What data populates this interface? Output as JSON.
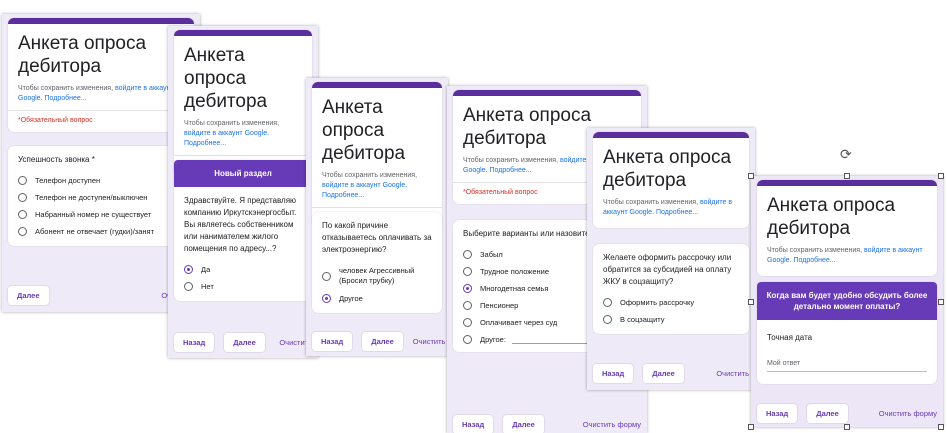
{
  "title": "Анкета опроса дебитора",
  "signin_text": "Чтобы сохранить изменения,",
  "signin_link": "войдите в аккаунт Google.",
  "signin_more": "Подробнее...",
  "required_note": "*Обязательный вопрос",
  "buttons": {
    "next": "Далее",
    "back": "Назад",
    "clear_short": "Очистить",
    "clear_full": "Очистить форму"
  },
  "screen1": {
    "question": "Успешность звонка *",
    "options": [
      "Телефон доступен",
      "Телефон не доступен/выключен",
      "Набранный номер не существует",
      "Абонент не отвечает (гудки)/занят"
    ]
  },
  "screen2": {
    "section": "Новый раздел",
    "question": "Здравствуйте. Я представляю компанию Иркутскэнергосбыт. Вы являетесь собственником или нанимателем жилого помещения по адресу...?",
    "options": [
      "Да",
      "Нет"
    ],
    "selected": 0
  },
  "screen3": {
    "question": "По какой причине отказываетесь оплачивать за электроэнергию?",
    "options": [
      "человек Агрессивный (Бросил трубку)",
      "Другое"
    ],
    "selected": 1
  },
  "screen4": {
    "question": "Выберите варианты или назовите свой",
    "options": [
      "Забыл",
      "Трудное положение",
      "Многодетная семья",
      "Пенсионер",
      "Оплачивает через суд",
      "Другое:"
    ],
    "selected": 2
  },
  "screen5": {
    "question": "Желаете оформить рассрочку или обратится за субсидией на оплату ЖКУ в соцзащиту?",
    "options": [
      "Оформить рассрочку",
      "В соцзащиту"
    ]
  },
  "screen6": {
    "section": "Когда вам будет удобно обсудить более детально момент оплаты?",
    "question": "Точная дата",
    "answer_placeholder": "Мой ответ"
  }
}
